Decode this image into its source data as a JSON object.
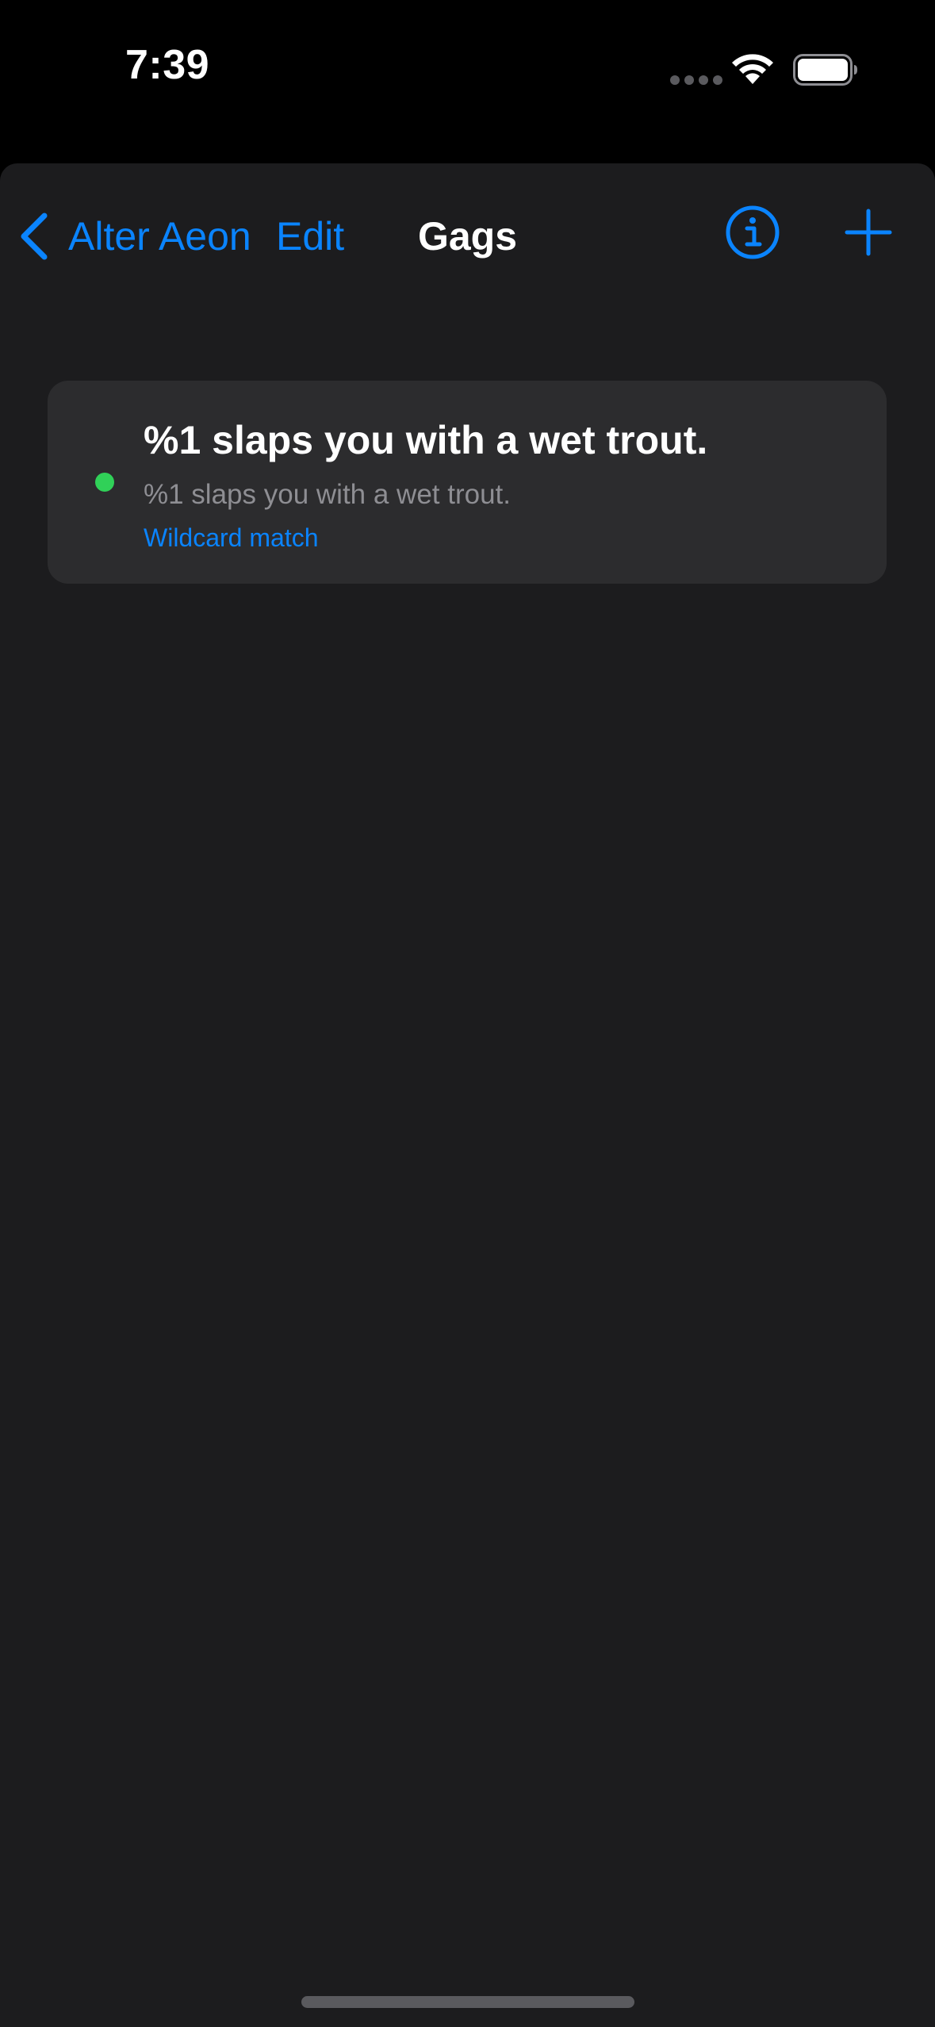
{
  "status_bar": {
    "time": "7:39",
    "icons": [
      "cellular-dots-icon",
      "wifi-icon",
      "battery-icon"
    ]
  },
  "nav": {
    "back_label": "Alter Aeon",
    "edit_label": "Edit",
    "title": "Gags",
    "icons": [
      "chevron-left-icon",
      "info-circle-icon",
      "plus-icon"
    ]
  },
  "gags": [
    {
      "title": "%1 slaps you with a wet trout.",
      "pattern": "%1 slaps you with a wet trout.",
      "match_type": "Wildcard match",
      "enabled": true
    }
  ],
  "colors": {
    "accent": "#0a84ff",
    "enabled": "#30d158",
    "background": "#1c1c1e",
    "card": "#2c2c2e",
    "secondary_text": "#8e8e93"
  }
}
